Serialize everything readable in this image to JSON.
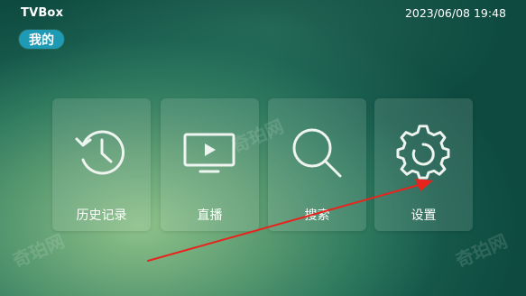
{
  "header": {
    "app_title": "TVBox",
    "datetime": "2023/06/08 19:48",
    "mine_label": "我的"
  },
  "menu": {
    "items": [
      {
        "label": "历史记录",
        "icon": "history-clock-icon"
      },
      {
        "label": "直播",
        "icon": "tv-play-icon"
      },
      {
        "label": "搜索",
        "icon": "search-icon"
      },
      {
        "label": "设置",
        "icon": "gear-icon"
      }
    ]
  },
  "watermark": {
    "text": "奇珀网"
  },
  "colors": {
    "accent_badge": "#1f9ab5",
    "annotation_arrow": "#e8231d"
  }
}
